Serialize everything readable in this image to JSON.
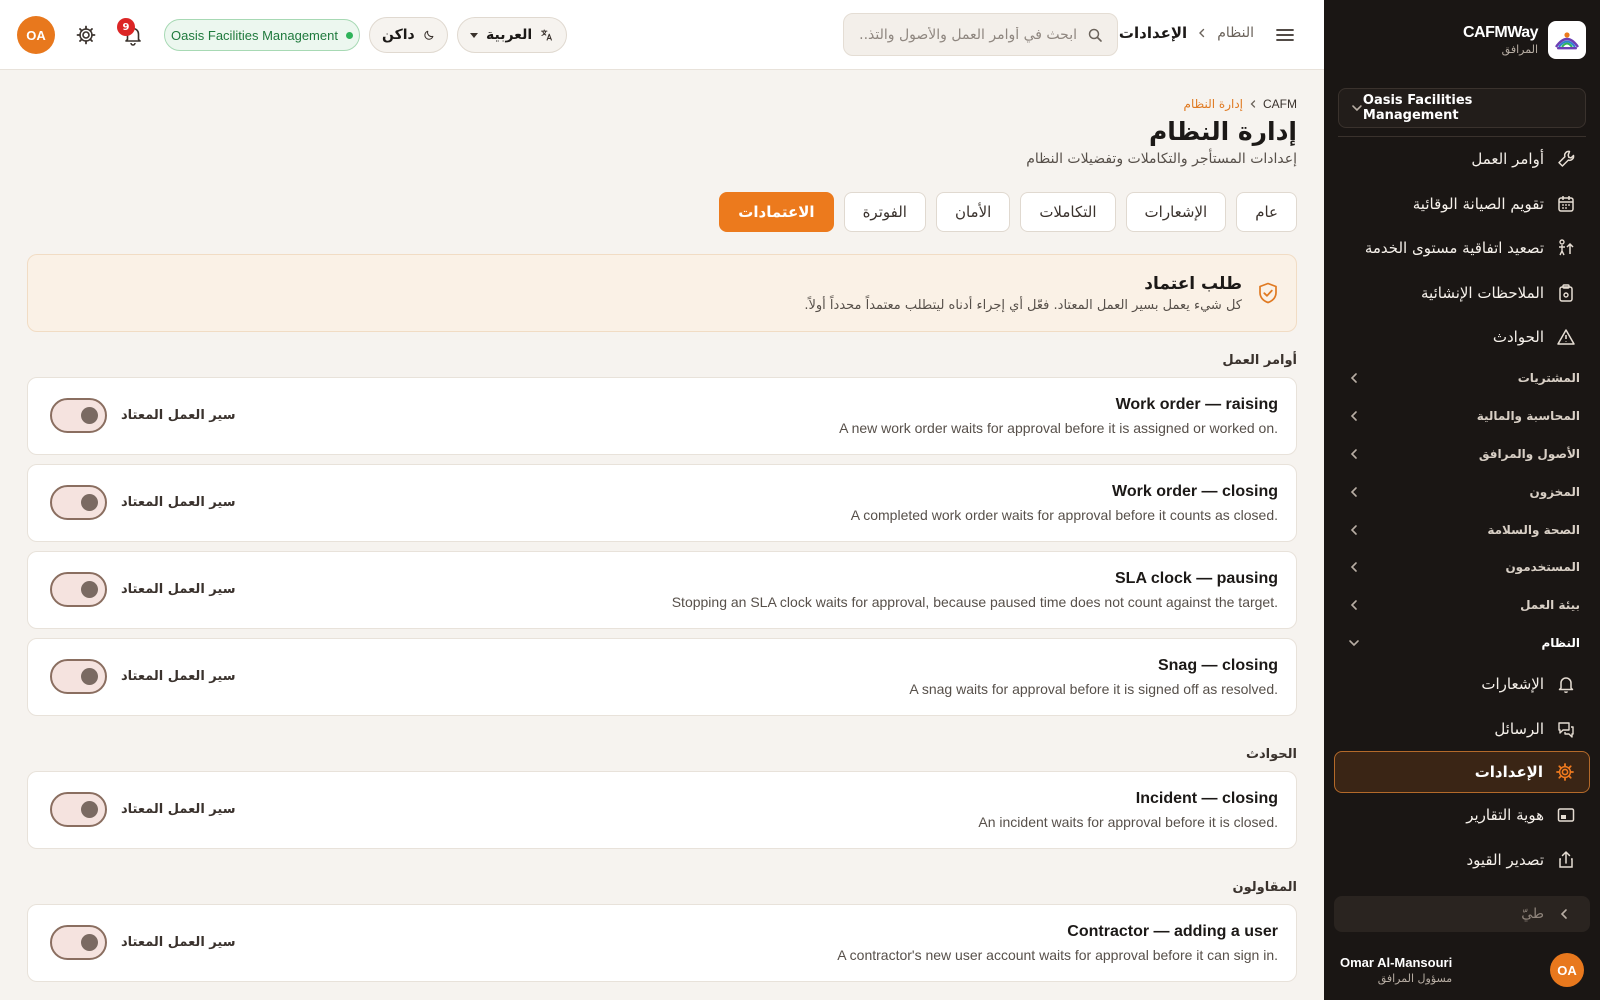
{
  "sidebar": {
    "brand_name": "CAFMWay",
    "brand_sub": "المرافق",
    "tenant": "Oasis Facilities Management",
    "items_top": [
      {
        "label": "أوامر العمل",
        "icon": "wrench-icon"
      },
      {
        "label": "تقويم الصيانة الوقائية",
        "icon": "calendar-icon"
      },
      {
        "label": "تصعيد اتفاقية مستوى الخدمة",
        "icon": "escalation-icon"
      },
      {
        "label": "الملاحظات الإنشائية",
        "icon": "clipboard-icon"
      },
      {
        "label": "الحوادث",
        "icon": "warning-icon"
      }
    ],
    "groups": [
      "المشتريات",
      "المحاسبة والمالية",
      "الأصول والمرافق",
      "المخزون",
      "الصحة والسلامة",
      "المستخدمون",
      "بيئة العمل"
    ],
    "open_group": "النظام",
    "items_system": [
      {
        "label": "الإشعارات",
        "icon": "bell-icon"
      },
      {
        "label": "الرسائل",
        "icon": "chat-icon"
      },
      {
        "label": "الإعدادات",
        "icon": "gear-icon"
      },
      {
        "label": "هوية التقارير",
        "icon": "report-icon"
      },
      {
        "label": "تصدير القيود",
        "icon": "export-icon"
      }
    ],
    "collapse_label": "طيّ",
    "user": {
      "initials": "OA",
      "name": "Omar Al-Mansouri",
      "role": "مسؤول المرافق"
    }
  },
  "header": {
    "breadcrumb_parent": "النظام",
    "breadcrumb_current": "الإعدادات",
    "search_placeholder": "ابحث في أوامر العمل والأصول والتذ...",
    "language": "العربية",
    "theme": "داكن",
    "tenant_badge": "Oasis Facilities Management",
    "notifications_count": "9",
    "avatar_initials": "OA"
  },
  "page": {
    "breadcrumb_root": "CAFM",
    "breadcrumb_current": "إدارة النظام",
    "title": "إدارة النظام",
    "subtitle": "إعدادات المستأجر والتكاملات وتفضيلات النظام",
    "tabs": [
      "عام",
      "الإشعارات",
      "التكاملات",
      "الأمان",
      "الفوترة",
      "الاعتمادات"
    ],
    "active_tab": "الاعتمادات",
    "banner": {
      "title": "طلب اعتماد",
      "text": "كل شيء يعمل بسير العمل المعتاد. فعّل أي إجراء أدناه ليتطلب معتمداً محدداً أولاً."
    },
    "toggle_label": "سير العمل المعتاد",
    "sections": [
      {
        "label": "أوامر العمل",
        "items": [
          {
            "title": "Work order — raising",
            "desc": "A new work order waits for approval before it is assigned or worked on.",
            "enabled": false
          },
          {
            "title": "Work order — closing",
            "desc": "A completed work order waits for approval before it counts as closed.",
            "enabled": false
          },
          {
            "title": "SLA clock — pausing",
            "desc": "Stopping an SLA clock waits for approval, because paused time does not count against the target.",
            "enabled": false
          },
          {
            "title": "Snag — closing",
            "desc": "A snag waits for approval before it is signed off as resolved.",
            "enabled": false
          }
        ]
      },
      {
        "label": "الحوادث",
        "items": [
          {
            "title": "Incident — closing",
            "desc": "An incident waits for approval before it is closed.",
            "enabled": false
          }
        ]
      },
      {
        "label": "المقاولون",
        "items": [
          {
            "title": "Contractor — adding a user",
            "desc": "A contractor's new user account waits for approval before it can sign in.",
            "enabled": false
          }
        ]
      }
    ]
  },
  "colors": {
    "accent": "#ec7a1d",
    "sidebar_bg": "#1a1614",
    "success": "#2fb35a",
    "danger": "#dc2626"
  }
}
